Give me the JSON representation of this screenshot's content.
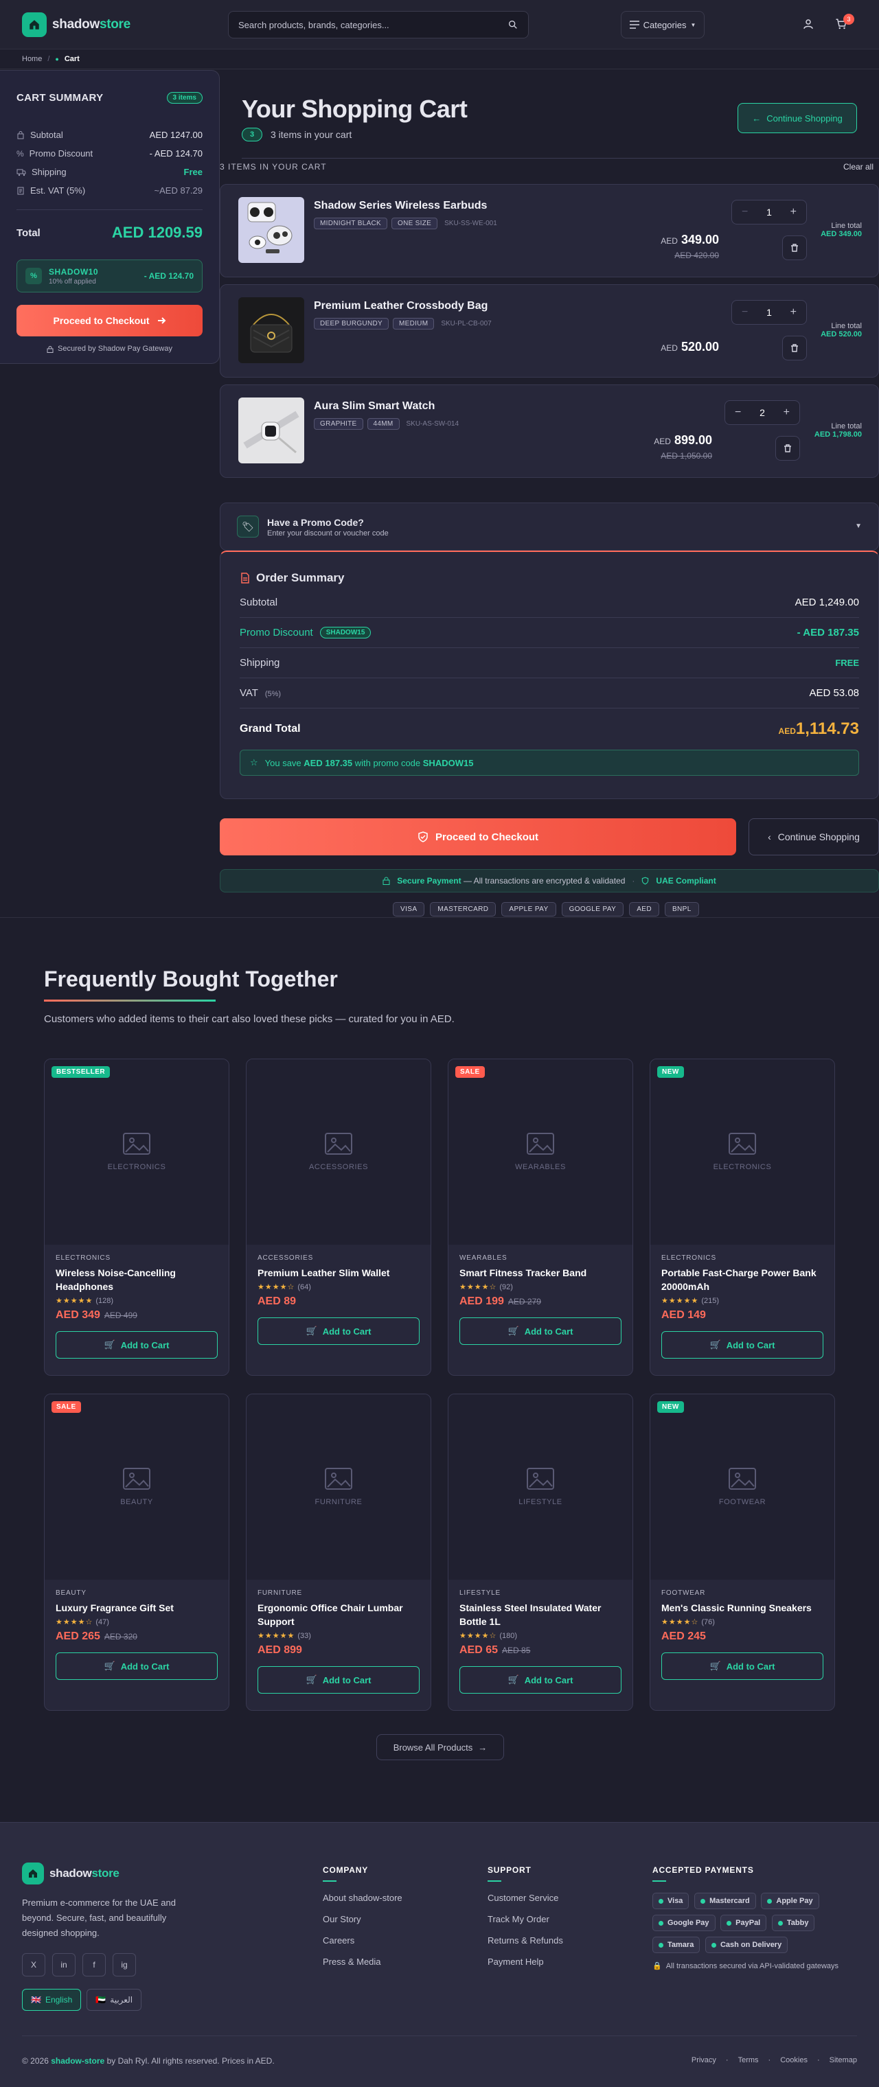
{
  "header": {
    "logo_a": "shadow",
    "logo_b": "store",
    "search_placeholder": "Search products, brands, categories...",
    "categories_label": "Categories",
    "cart_count": "3"
  },
  "breadcrumb": {
    "home": "Home",
    "current": "Cart"
  },
  "summary": {
    "title": "CART SUMMARY",
    "items_badge": "3 items",
    "subtotal_label": "Subtotal",
    "subtotal_value": "AED 1247.00",
    "promo_label": "Promo Discount",
    "promo_value": "- AED 124.70",
    "shipping_label": "Shipping",
    "shipping_value": "Free",
    "vat_label": "Est. VAT (5%)",
    "vat_value": "~AED 87.29",
    "total_label": "Total",
    "total_value": "AED 1209.59",
    "coupon_code": "SHADOW10",
    "coupon_desc": "10% off applied",
    "coupon_value": "- AED 124.70",
    "checkout_label": "Proceed to Checkout",
    "secured_label": "Secured by Shadow Pay Gateway"
  },
  "cart": {
    "title": "Your Shopping Cart",
    "count": "3",
    "count_text": "3 items in your cart",
    "continue_label": "Continue Shopping",
    "list_header": "3 ITEMS IN YOUR CART",
    "clear_all": "Clear all",
    "line_total_label": "Line total",
    "currency": "AED",
    "items": [
      {
        "name": "Shadow Series Wireless Earbuds",
        "tag1": "MIDNIGHT BLACK",
        "tag2": "ONE SIZE",
        "sku": "SKU-SS-WE-001",
        "qty": "1",
        "price": "349.00",
        "old_price": "AED 420.00",
        "line_total": "AED 349.00"
      },
      {
        "name": "Premium Leather Crossbody Bag",
        "tag1": "DEEP BURGUNDY",
        "tag2": "MEDIUM",
        "sku": "SKU-PL-CB-007",
        "qty": "1",
        "price": "520.00",
        "old_price": "",
        "line_total": "AED 520.00"
      },
      {
        "name": "Aura Slim Smart Watch",
        "tag1": "GRAPHITE",
        "tag2": "44MM",
        "sku": "SKU-AS-SW-014",
        "qty": "2",
        "price": "899.00",
        "old_price": "AED 1,050.00",
        "line_total": "AED 1,798.00"
      }
    ]
  },
  "promo": {
    "title": "Have a Promo Code?",
    "subtitle": "Enter your discount or voucher code"
  },
  "order_summary": {
    "title": "Order Summary",
    "subtotal_label": "Subtotal",
    "subtotal_value": "AED 1,249.00",
    "promo_label": "Promo Discount",
    "promo_code": "SHADOW15",
    "promo_value": "- AED 187.35",
    "shipping_label": "Shipping",
    "shipping_value": "FREE",
    "vat_label": "VAT",
    "vat_rate": "(5%)",
    "vat_value": "AED 53.08",
    "grand_label": "Grand Total",
    "grand_currency": "AED",
    "grand_value": "1,114.73",
    "save_prefix": "You save",
    "save_amount": "AED 187.35",
    "save_mid": "with promo code",
    "save_code": "SHADOW15"
  },
  "actions": {
    "checkout_label": "Proceed to Checkout",
    "continue_label": "Continue Shopping",
    "secure_title": "Secure Payment",
    "secure_text": "— All transactions are encrypted & validated",
    "uae_label": "UAE Compliant",
    "payment_chips": [
      "VISA",
      "MASTERCARD",
      "APPLE PAY",
      "GOOGLE PAY",
      "AED",
      "BNPL"
    ]
  },
  "fbt": {
    "title": "Frequently Bought Together",
    "subtitle": "Customers who added items to their cart also loved these picks — curated for you in AED.",
    "add_label": "Add to Cart",
    "browse_label": "Browse All Products",
    "products": [
      {
        "badge": "BESTSELLER",
        "badge_color": "#16b98c",
        "category": "ELECTRONICS",
        "name": "Wireless Noise-Cancelling Headphones",
        "stars": "★★★★★",
        "reviews": "(128)",
        "price": "AED 349",
        "old": "AED 499"
      },
      {
        "badge": "",
        "badge_color": "",
        "category": "ACCESSORIES",
        "name": "Premium Leather Slim Wallet",
        "stars": "★★★★☆",
        "reviews": "(64)",
        "price": "AED 89",
        "old": ""
      },
      {
        "badge": "SALE",
        "badge_color": "#ff5b4e",
        "category": "WEARABLES",
        "name": "Smart Fitness Tracker Band",
        "stars": "★★★★☆",
        "reviews": "(92)",
        "price": "AED 199",
        "old": "AED 279"
      },
      {
        "badge": "NEW",
        "badge_color": "#16b98c",
        "category": "ELECTRONICS",
        "name": "Portable Fast-Charge Power Bank 20000mAh",
        "stars": "★★★★★",
        "reviews": "(215)",
        "price": "AED 149",
        "old": ""
      },
      {
        "badge": "SALE",
        "badge_color": "#ff5b4e",
        "category": "BEAUTY",
        "name": "Luxury Fragrance Gift Set",
        "stars": "★★★★☆",
        "reviews": "(47)",
        "price": "AED 265",
        "old": "AED 320"
      },
      {
        "badge": "",
        "badge_color": "",
        "category": "FURNITURE",
        "name": "Ergonomic Office Chair Lumbar Support",
        "stars": "★★★★★",
        "reviews": "(33)",
        "price": "AED 899",
        "old": ""
      },
      {
        "badge": "",
        "badge_color": "",
        "category": "LIFESTYLE",
        "name": "Stainless Steel Insulated Water Bottle 1L",
        "stars": "★★★★☆",
        "reviews": "(180)",
        "price": "AED 65",
        "old": "AED 85"
      },
      {
        "badge": "NEW",
        "badge_color": "#16b98c",
        "category": "FOOTWEAR",
        "name": "Men's Classic Running Sneakers",
        "stars": "★★★★☆",
        "reviews": "(76)",
        "price": "AED 245",
        "old": ""
      }
    ]
  },
  "footer": {
    "logo_a": "shadow",
    "logo_b": "store",
    "tagline": "Premium e-commerce for the UAE and beyond. Secure, fast, and beautifully designed shopping.",
    "social": [
      "X",
      "in",
      "f",
      "ig"
    ],
    "lang_en": "English",
    "lang_ar": "العربية",
    "company_title": "COMPANY",
    "company_links": [
      "About shadow-store",
      "Our Story",
      "Careers",
      "Press & Media"
    ],
    "support_title": "SUPPORT",
    "support_links": [
      "Customer Service",
      "Track My Order",
      "Returns & Refunds",
      "Payment Help"
    ],
    "payments_title": "ACCEPTED PAYMENTS",
    "payments": [
      "Visa",
      "Mastercard",
      "Apple Pay",
      "Google Pay",
      "PayPal",
      "Tabby",
      "Tamara",
      "Cash on Delivery"
    ],
    "payments_note": "All transactions secured via API-validated gateways",
    "copy_a": "© 2026",
    "copy_brand": "shadow-store",
    "copy_b": "by Dah Ryl. All rights reserved. Prices in AED.",
    "bottom_links": [
      "Privacy",
      "Terms",
      "Cookies",
      "Sitemap"
    ]
  }
}
